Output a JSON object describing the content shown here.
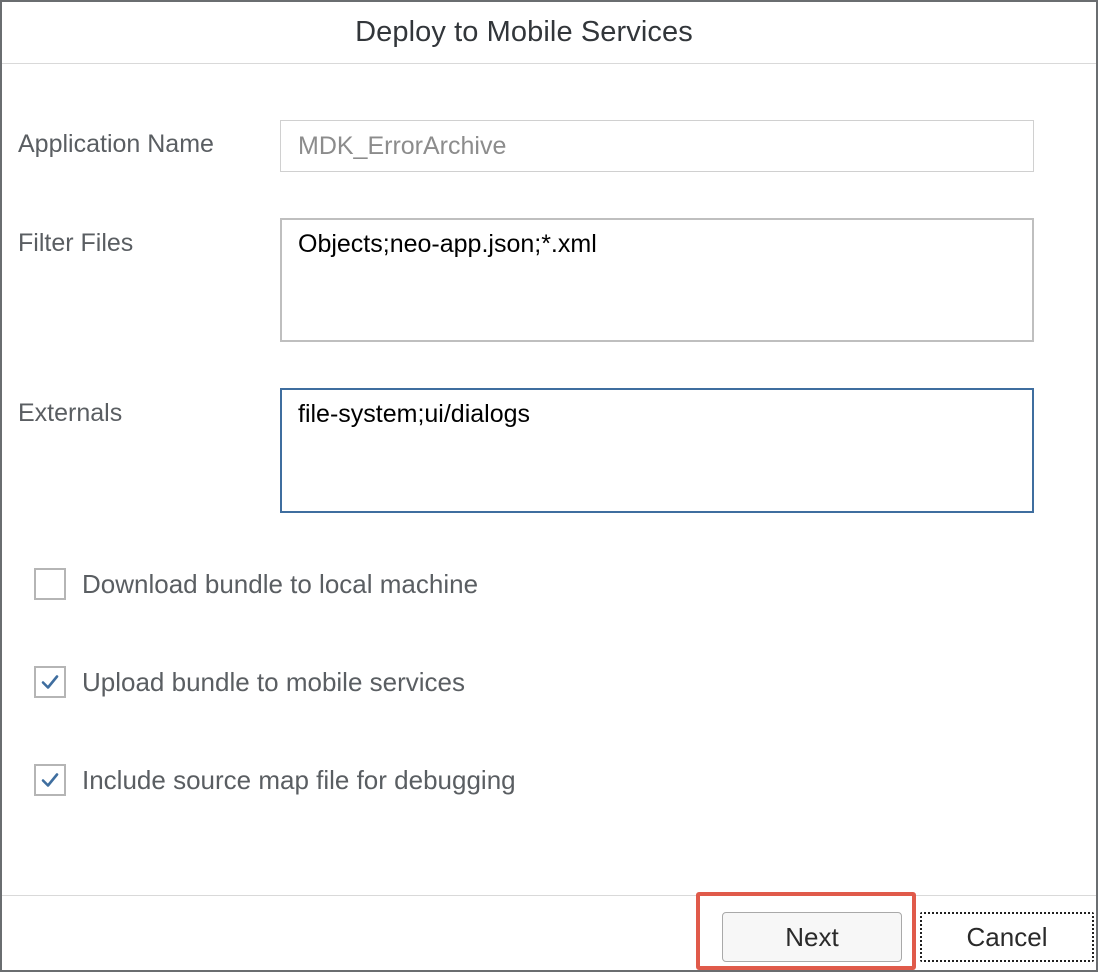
{
  "dialog": {
    "title": "Deploy to Mobile Services"
  },
  "form": {
    "application_name": {
      "label": "Application Name",
      "value": "MDK_ErrorArchive"
    },
    "filter_files": {
      "label": "Filter Files",
      "value": "Objects;neo-app.json;*.xml"
    },
    "externals": {
      "label": "Externals",
      "value": "file-system;ui/dialogs"
    }
  },
  "options": [
    {
      "label": "Download bundle to local machine",
      "checked": false
    },
    {
      "label": "Upload bundle to mobile services",
      "checked": true
    },
    {
      "label": "Include source map file for debugging",
      "checked": true
    }
  ],
  "footer": {
    "next_label": "Next",
    "cancel_label": "Cancel"
  },
  "colors": {
    "highlight": "#e05a4a",
    "focus_border": "#3f6e9f",
    "check_mark": "#3f6e9f"
  }
}
